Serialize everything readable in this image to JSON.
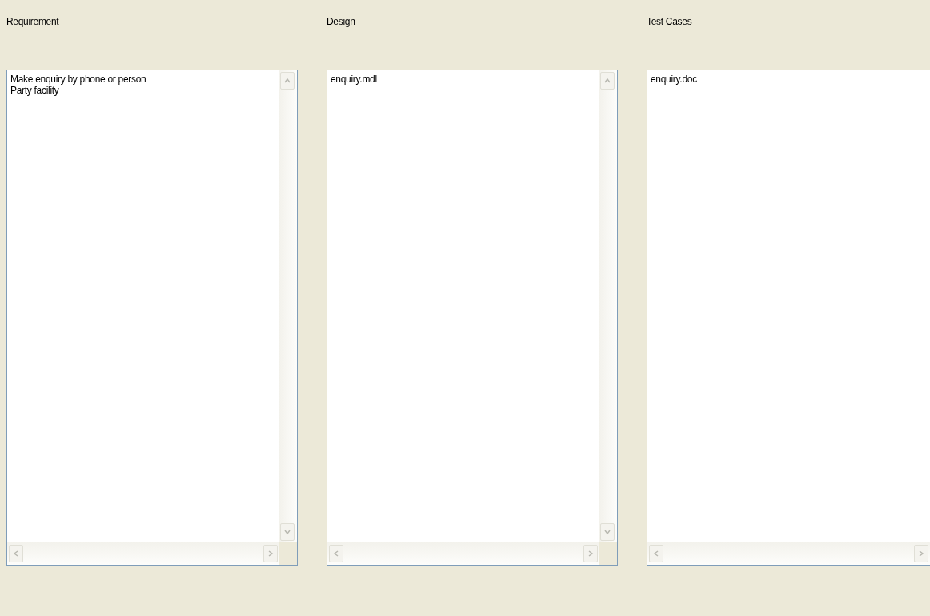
{
  "panels": [
    {
      "label": "Requirement",
      "lines": [
        "Make enquiry by phone or person",
        "Party facility"
      ],
      "vertical_scrollbar": true
    },
    {
      "label": "Design",
      "lines": [
        "enquiry.mdl"
      ],
      "vertical_scrollbar": true
    },
    {
      "label": "Test Cases",
      "lines": [
        "enquiry.doc"
      ],
      "vertical_scrollbar": false
    }
  ]
}
